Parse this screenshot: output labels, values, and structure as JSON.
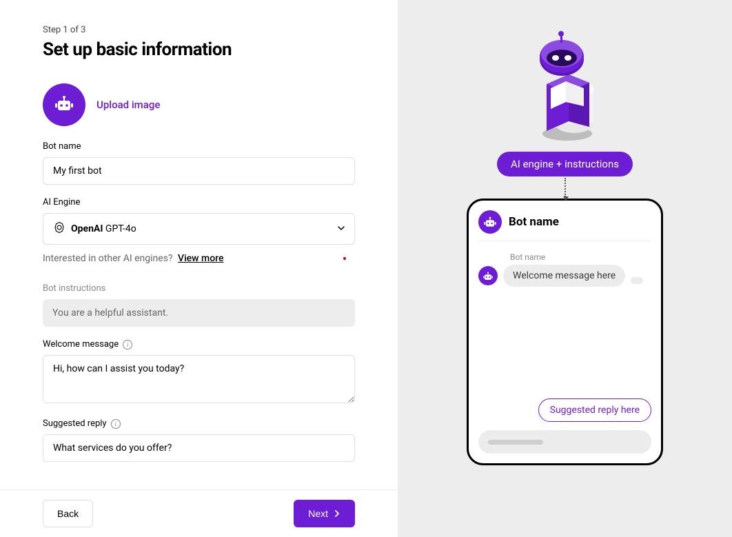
{
  "step": "Step 1 of 3",
  "title": "Set up basic information",
  "avatar": {
    "upload_label": "Upload image"
  },
  "bot_name": {
    "label": "Bot name",
    "value": "My first bot"
  },
  "ai_engine": {
    "label": "AI Engine",
    "brand": "OpenAI",
    "model": "GPT-4o",
    "helper_text": "Interested in other AI engines?",
    "helper_link": "View more"
  },
  "bot_instructions": {
    "label": "Bot instructions",
    "value": "You are a helpful assistant."
  },
  "welcome_message": {
    "label": "Welcome message",
    "value": "Hi, how can I assist you today?"
  },
  "suggested_reply": {
    "label": "Suggested reply",
    "value": "What services do you offer?"
  },
  "footer": {
    "back_label": "Back",
    "next_label": "Next"
  },
  "preview": {
    "engine_pill": "AI engine + instructions",
    "chat_title": "Bot name",
    "bot_label": "Bot name",
    "welcome_placeholder": "Welcome message here",
    "suggested_placeholder": "Suggested reply here"
  }
}
